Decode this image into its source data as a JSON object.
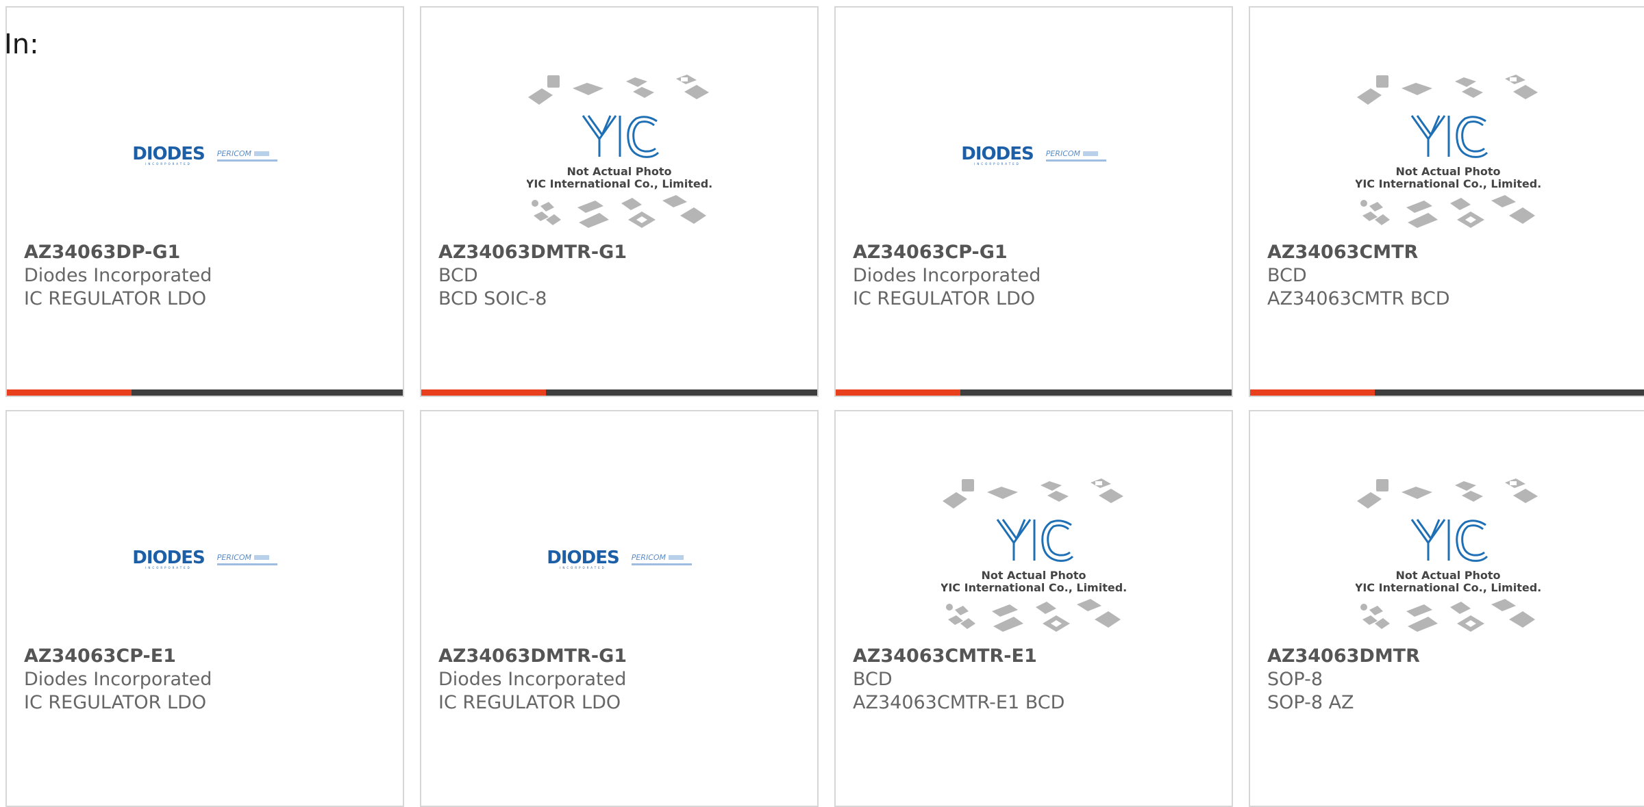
{
  "page": {
    "label": "In:"
  },
  "products": [
    {
      "part": "AZ34063DP-G1",
      "manufacturer": "Diodes Incorporated",
      "description": "IC REGULATOR LDO",
      "image": "diodes-pericom-logo"
    },
    {
      "part": "AZ34063DMTR-G1",
      "manufacturer": "BCD",
      "description": "BCD SOIC-8",
      "image": "yic-placeholder"
    },
    {
      "part": "AZ34063CP-G1",
      "manufacturer": "Diodes Incorporated",
      "description": "IC REGULATOR LDO",
      "image": "diodes-pericom-logo"
    },
    {
      "part": "AZ34063CMTR",
      "manufacturer": "BCD",
      "description": "AZ34063CMTR BCD",
      "image": "yic-placeholder"
    },
    {
      "part": "AZ34063CP-E1",
      "manufacturer": "Diodes Incorporated",
      "description": "IC REGULATOR LDO",
      "image": "diodes-pericom-logo"
    },
    {
      "part": "AZ34063DMTR-G1",
      "manufacturer": "Diodes Incorporated",
      "description": "IC REGULATOR LDO",
      "image": "diodes-pericom-logo"
    },
    {
      "part": "AZ34063CMTR-E1",
      "manufacturer": "BCD",
      "description": "AZ34063CMTR-E1 BCD",
      "image": "yic-placeholder"
    },
    {
      "part": "AZ34063DMTR",
      "manufacturer": "SOP-8",
      "description": "SOP-8 AZ",
      "image": "yic-placeholder"
    }
  ],
  "logos": {
    "diodes": {
      "word": "DIODES",
      "sub": "INCORPORATED"
    },
    "pericom": {
      "word": "PERICOM"
    }
  },
  "placeholder": {
    "line1": "Not Actual Photo",
    "line2": "YIC International Co., Limited.",
    "brand": "YIC"
  },
  "colors": {
    "accent_red": "#e8401c",
    "bar_dark": "#3e3e3e",
    "card_border": "#d6d6d6",
    "diodes_blue": "#1d5fa6",
    "yic_blue": "#1f6fb5"
  }
}
